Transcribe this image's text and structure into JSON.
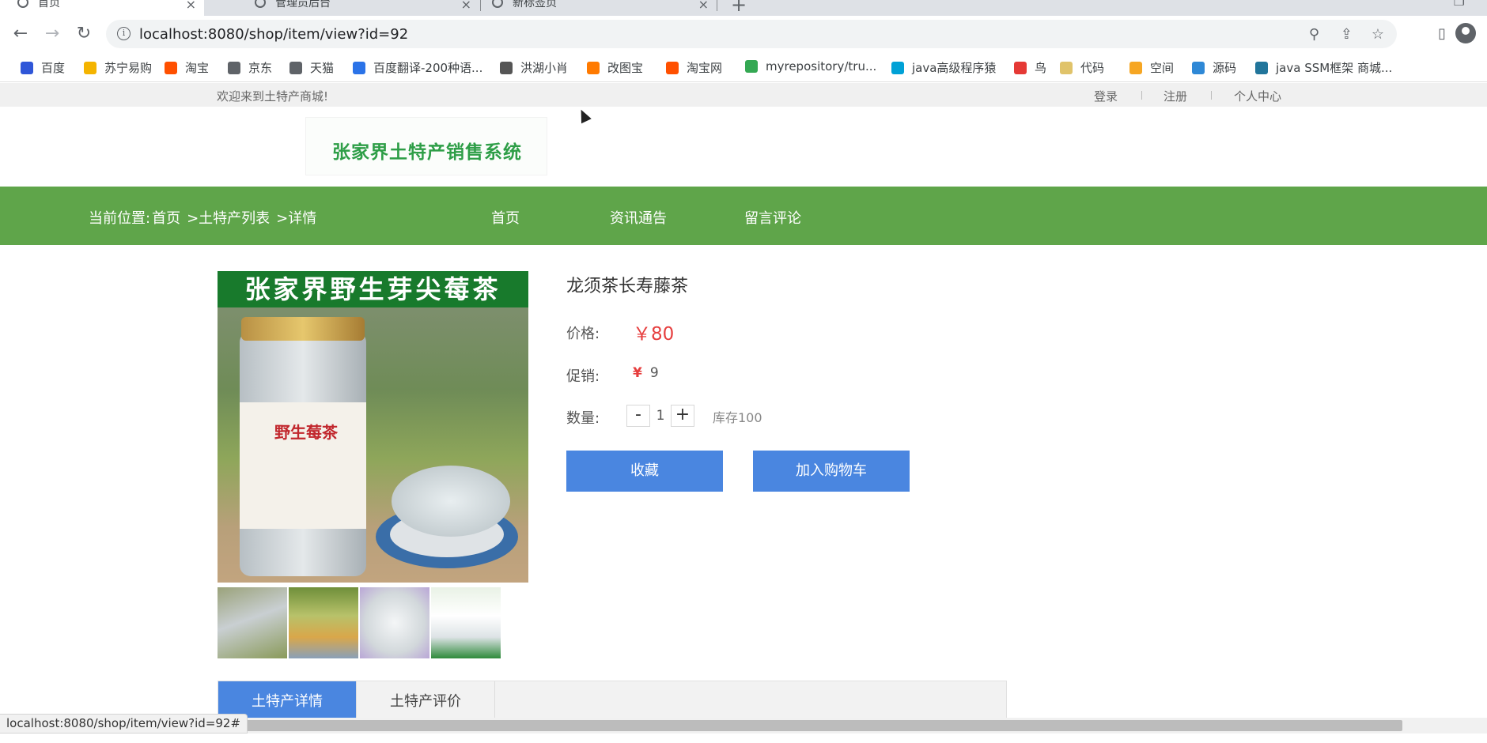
{
  "browser": {
    "tabs": [
      {
        "label": "首页",
        "active": true
      },
      {
        "label": "管理员后台",
        "active": false
      },
      {
        "label": "新标签页",
        "active": false
      }
    ],
    "url": "localhost:8080/shop/item/view?id=92",
    "status_url": "localhost:8080/shop/item/view?id=92#",
    "bookmarks": [
      {
        "label": "百度",
        "icon": "baidu-icon",
        "color": "#2f56d8"
      },
      {
        "label": "苏宁易购",
        "icon": "suning-icon",
        "color": "#f4b400"
      },
      {
        "label": "淘宝",
        "icon": "taobao-icon",
        "color": "#ff5000"
      },
      {
        "label": "京东",
        "icon": "globe-icon",
        "color": "#5f6368"
      },
      {
        "label": "天猫",
        "icon": "globe-icon",
        "color": "#5f6368"
      },
      {
        "label": "百度翻译-200种语...",
        "icon": "translate-icon",
        "color": "#2b73e8"
      },
      {
        "label": "洪湖小肖",
        "icon": "bird-icon",
        "color": "#555555"
      },
      {
        "label": "改图宝",
        "icon": "image-icon",
        "color": "#ff7a00"
      },
      {
        "label": "淘宝网",
        "icon": "taobao-icon",
        "color": "#ff5000"
      },
      {
        "label": "myrepository/tru...",
        "icon": "chrome-icon",
        "color": "#34a853"
      },
      {
        "label": "java高级程序猿",
        "icon": "bilibili-icon",
        "color": "#00a1d6"
      },
      {
        "label": "鸟",
        "icon": "bird-icon",
        "color": "#e53935"
      },
      {
        "label": "代码",
        "icon": "leaf-icon",
        "color": "#e0c36a"
      },
      {
        "label": "空间",
        "icon": "qzone-icon",
        "color": "#f6a623"
      },
      {
        "label": "源码",
        "icon": "fish-icon",
        "color": "#2e88d6"
      },
      {
        "label": "java SSM框架 商城...",
        "icon": "wordpress-icon",
        "color": "#21759b"
      }
    ]
  },
  "topbar": {
    "welcome": "欢迎来到土特产商城!",
    "login": "登录",
    "register": "注册",
    "profile": "个人中心"
  },
  "logo": {
    "text": "张家界土特产销售系统"
  },
  "nav": {
    "crumb_prefix": "当前位置:",
    "crumb_home": "首页",
    "crumb_list": ">土特产列表",
    "crumb_detail": ">详情",
    "items": [
      "首页",
      "资讯通告",
      "留言评论"
    ]
  },
  "product": {
    "image_banner": "张家界野生芽尖莓茶",
    "image_label": "野生莓茶",
    "name": "龙须茶长寿藤茶",
    "price_label": "价格:",
    "price": "￥80",
    "promo_label": "促销:",
    "promo_symbol": "¥",
    "promo_value": "9",
    "qty_label": "数量:",
    "qty_minus": "-",
    "qty_value": "1",
    "qty_plus": "+",
    "stock": "库存100",
    "favorite_button": "收藏",
    "cart_button": "加入购物车"
  },
  "detail_tabs": [
    "土特产详情",
    "土特产评价"
  ],
  "colors": {
    "green_nav": "#5fa54a",
    "button_blue": "#4a86e0",
    "price_red": "#e63e3e"
  }
}
